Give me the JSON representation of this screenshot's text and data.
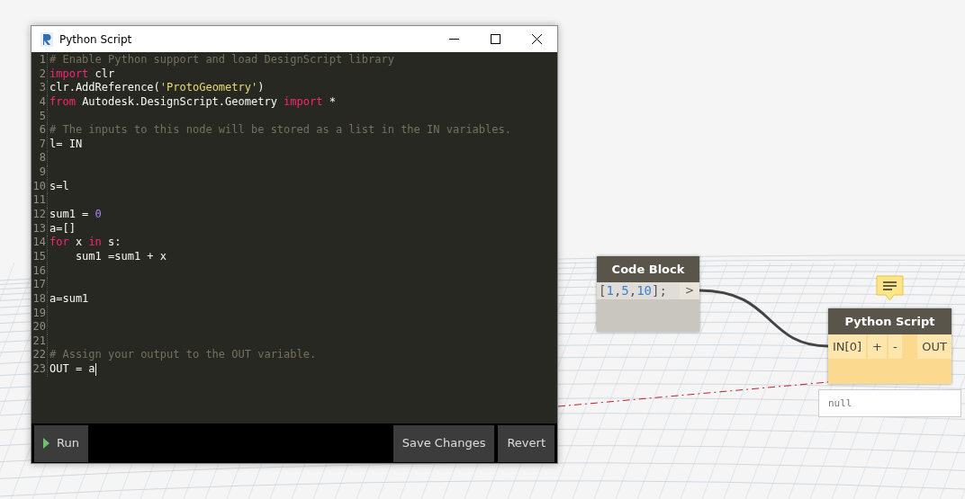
{
  "window": {
    "title": "Python Script"
  },
  "editor": {
    "lines": [
      {
        "number": "1",
        "tokens": [
          {
            "kind": "comment",
            "text": "# Enable Python support and load DesignScript library"
          }
        ]
      },
      {
        "number": "2",
        "tokens": [
          {
            "kind": "keyword",
            "text": "import"
          },
          {
            "kind": "plain",
            "text": " clr"
          }
        ]
      },
      {
        "number": "3",
        "tokens": [
          {
            "kind": "plain",
            "text": "clr.AddReference("
          },
          {
            "kind": "string",
            "text": "'ProtoGeometry'"
          },
          {
            "kind": "plain",
            "text": ")"
          }
        ]
      },
      {
        "number": "4",
        "tokens": [
          {
            "kind": "keyword",
            "text": "from"
          },
          {
            "kind": "plain",
            "text": " Autodesk.DesignScript.Geometry "
          },
          {
            "kind": "keyword",
            "text": "import"
          },
          {
            "kind": "plain",
            "text": " *"
          }
        ]
      },
      {
        "number": "5"
      },
      {
        "number": "6",
        "tokens": [
          {
            "kind": "comment",
            "text": "# The inputs to this node will be stored as a list in the IN variables."
          }
        ]
      },
      {
        "number": "7",
        "tokens": [
          {
            "kind": "plain",
            "text": "l= IN"
          }
        ]
      },
      {
        "number": "8"
      },
      {
        "number": "9"
      },
      {
        "number": "10",
        "tokens": [
          {
            "kind": "plain",
            "text": "s=l"
          }
        ]
      },
      {
        "number": "11"
      },
      {
        "number": "12",
        "tokens": [
          {
            "kind": "plain",
            "text": "sum1 = "
          },
          {
            "kind": "number",
            "text": "0"
          }
        ]
      },
      {
        "number": "13",
        "tokens": [
          {
            "kind": "plain",
            "text": "a=[]"
          }
        ]
      },
      {
        "number": "14",
        "tokens": [
          {
            "kind": "keyword",
            "text": "for"
          },
          {
            "kind": "plain",
            "text": " x "
          },
          {
            "kind": "keyword",
            "text": "in"
          },
          {
            "kind": "plain",
            "text": " s:"
          }
        ]
      },
      {
        "number": "15",
        "tokens": [
          {
            "kind": "plain",
            "text": "    sum1 =sum1 + x"
          }
        ]
      },
      {
        "number": "16"
      },
      {
        "number": "17"
      },
      {
        "number": "18",
        "tokens": [
          {
            "kind": "plain",
            "text": "a=sum1"
          }
        ]
      },
      {
        "number": "19"
      },
      {
        "number": "20"
      },
      {
        "number": "21"
      },
      {
        "number": "22",
        "tokens": [
          {
            "kind": "comment",
            "text": "# Assign your output to the OUT variable."
          }
        ]
      },
      {
        "number": "23",
        "tokens": [
          {
            "kind": "plain",
            "text": "OUT = a"
          }
        ],
        "cursor": true
      }
    ]
  },
  "buttons": [
    {
      "label": "Run",
      "kind": "run"
    },
    {
      "label": "Save Changes",
      "kind": "plain"
    },
    {
      "label": "Revert",
      "kind": "plain"
    }
  ],
  "code_block_node": {
    "title": "Code Block",
    "code": [
      {
        "kind": "plain",
        "text": "["
      },
      {
        "kind": "number",
        "text": "1"
      },
      {
        "kind": "plain",
        "text": ","
      },
      {
        "kind": "number",
        "text": "5"
      },
      {
        "kind": "plain",
        "text": ","
      },
      {
        "kind": "number",
        "text": "10"
      },
      {
        "kind": "plain",
        "text": "];"
      }
    ],
    "output_port": ">"
  },
  "python_node": {
    "title": "Python Script",
    "input_port": "IN[0]",
    "add_button": "+",
    "remove_button": "-",
    "output_port": "OUT",
    "preview": "null"
  }
}
